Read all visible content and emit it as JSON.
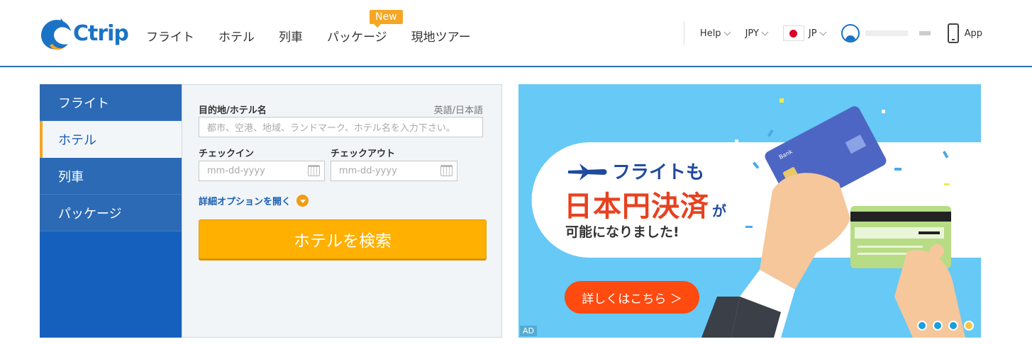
{
  "header": {
    "logo_text": "Ctrip",
    "nav": [
      {
        "label": "フライト"
      },
      {
        "label": "ホテル"
      },
      {
        "label": "列車"
      },
      {
        "label": "パッケージ",
        "badge": "New"
      },
      {
        "label": "現地ツアー"
      }
    ],
    "help": "Help",
    "currency": "JPY",
    "language": "JP",
    "app": "App",
    "accent_color": "#2b72b0"
  },
  "search": {
    "tabs": [
      {
        "label": "フライト",
        "active": false
      },
      {
        "label": "ホテル",
        "active": true
      },
      {
        "label": "列車",
        "active": false
      },
      {
        "label": "パッケージ",
        "active": false
      }
    ],
    "destination_label": "目的地/ホテル名",
    "language_hint": "英語/日本語",
    "destination_placeholder": "都市、空港、地域、ランドマーク、ホテル名を入力下さい。",
    "checkin_label": "チェックイン",
    "checkout_label": "チェックアウト",
    "checkin_placeholder": "mm-dd-yyyy",
    "checkout_placeholder": "mm-dd-yyyy",
    "more_options": "詳細オプションを開く",
    "search_button": "ホテルを検索",
    "button_color": "#ffb000"
  },
  "banner": {
    "line1": "フライトも",
    "line2": "日本円決済",
    "line2_suffix": "が",
    "line3": "可能になりました!",
    "cta": "詳しくはこちら ＞",
    "ad_label": "AD",
    "card_text": "Bank",
    "slide_count": 4,
    "active_slide": 4
  }
}
